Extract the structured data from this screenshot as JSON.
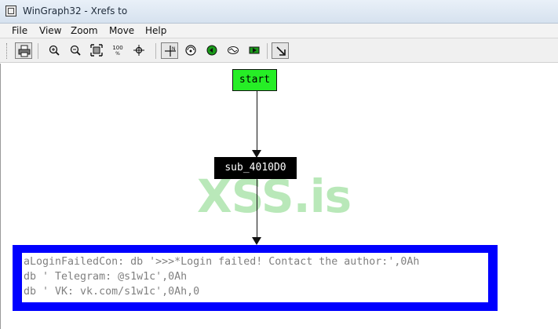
{
  "window": {
    "title": "WinGraph32 - Xrefs to"
  },
  "menu": {
    "items": [
      "File",
      "View",
      "Zoom",
      "Move",
      "Help"
    ]
  },
  "toolbar": {
    "icons": [
      "printer-icon",
      "zoom-in-icon",
      "zoom-out-icon",
      "fit-window-icon",
      "zoom-100-icon",
      "center-icon",
      "move-icon",
      "rotate-icon",
      "green-node-icon",
      "layout-icon",
      "next-node-icon",
      "arrow-cursor-icon"
    ],
    "zoom_100_label": "100",
    "zoom_100_sub": "%"
  },
  "graph": {
    "watermark": "XSS.is",
    "nodes": {
      "start": {
        "label": "start",
        "color": "#26ee26"
      },
      "sub": {
        "label": "sub_4010D0",
        "color": "#000000"
      },
      "data": {
        "border_color": "#0000ff",
        "lines": [
          "aLoginFailedCon: db '>>>*Login failed! Contact the author:',0Ah",
          "db ' Telegram: @s1w1c',0Ah",
          "db ' VK: vk.com/s1w1c',0Ah,0"
        ]
      }
    }
  }
}
